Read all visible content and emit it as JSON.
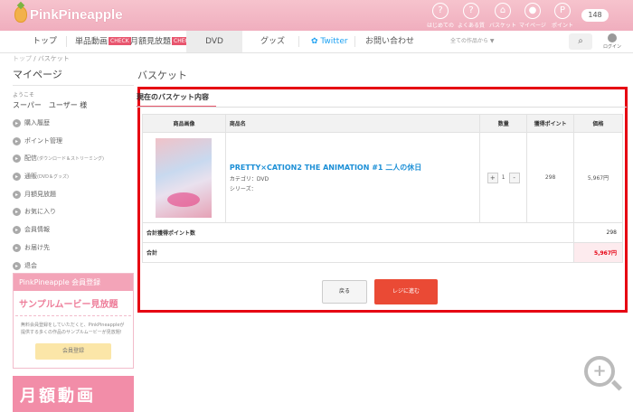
{
  "header": {
    "logo_text": "PinkPineapple",
    "icons": [
      {
        "name": "help-icon",
        "glyph": "?",
        "label": "はじめての方へ"
      },
      {
        "name": "faq-icon",
        "glyph": "?",
        "label": "よくある質問"
      },
      {
        "name": "cart-icon",
        "glyph": "⌂",
        "label": "バスケット"
      },
      {
        "name": "mypage-icon",
        "glyph": "●",
        "label": "マイページ"
      },
      {
        "name": "points-icon",
        "glyph": "P",
        "label": "ポイント"
      }
    ],
    "points_value": "148"
  },
  "nav": {
    "items": [
      "トップ",
      "単品動画",
      "月額見放題",
      "DVD",
      "グッズ",
      "Twitter",
      "お問い合わせ"
    ],
    "badge": "CHECK",
    "search_placeholder": "全ての作品から ▼",
    "search_icon": "⌕",
    "login_label": "ログイン"
  },
  "breadcrumb": [
    "トップ",
    "バスケット"
  ],
  "sidebar": {
    "title": "マイページ",
    "welcome": "ようこそ",
    "username": "スーパー　ユーザー 様",
    "items": [
      "購入履歴",
      "ポイント管理",
      "配信",
      "通販",
      "月額見放題",
      "お気に入り",
      "会員情報",
      "お届け先",
      "退会"
    ],
    "item_notes": {
      "2": "(ダウンロード＆ストリーミング)",
      "3": "(DVD＆グッズ)"
    },
    "reg_header": "PinkPineapple 会員登録",
    "reg_headline": "サンプルムービー見放題",
    "reg_desc": "無料会員登録をしていただくと、PinkPineappleが提供する多くの作品のサンプルムービーが見放題!",
    "reg_button": "会員登録",
    "ad_text": "月額動画"
  },
  "page": {
    "title": "バスケット",
    "cart_title": "現在のバスケット内容",
    "columns": [
      "商品画像",
      "商品名",
      "数量",
      "獲得ポイント",
      "価格"
    ],
    "item": {
      "name": "PRETTY×CATION2 THE ANIMATION #1 二人の休日",
      "category": "カテゴリ：DVD",
      "series": "シリーズ：",
      "qty": "1",
      "minus": "-",
      "plus": "+",
      "points": "298",
      "price": "5,967円"
    },
    "points_total_label": "合計獲得ポイント数",
    "points_total": "298",
    "total_label": "合計",
    "total": "5,967円",
    "back_button": "戻る",
    "checkout_button": "レジに進む"
  }
}
